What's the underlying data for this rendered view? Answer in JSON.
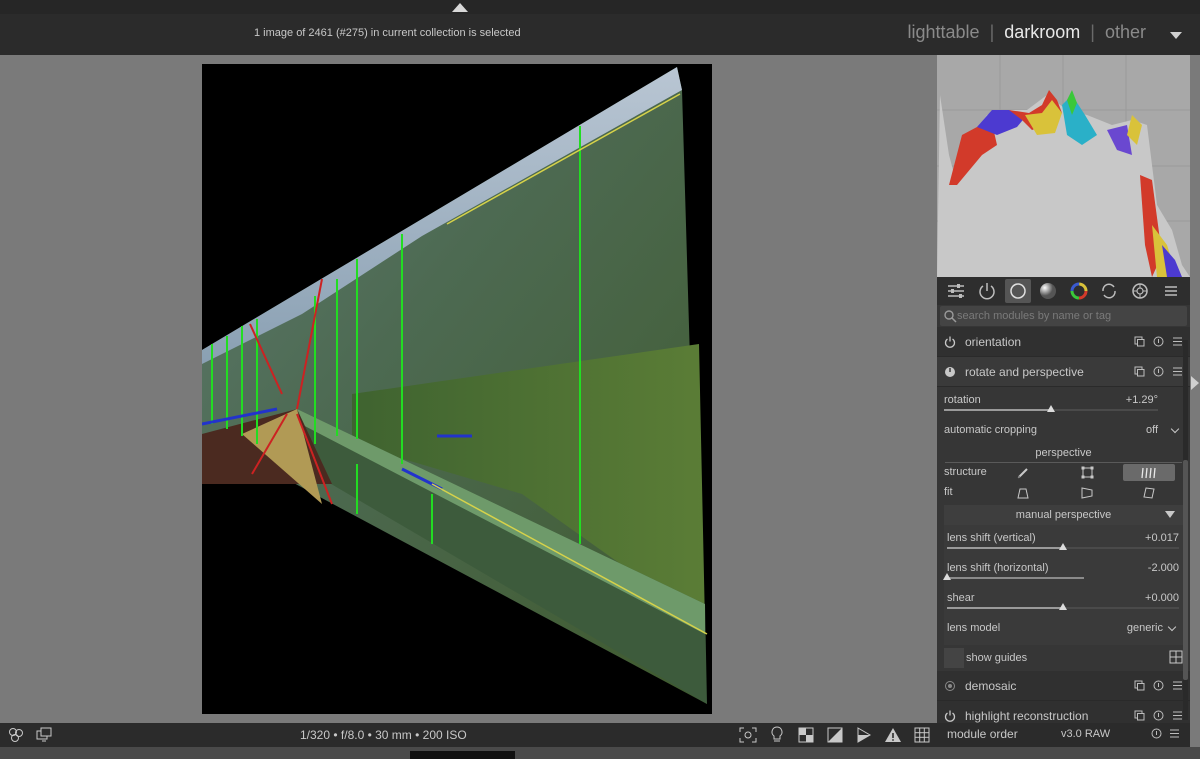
{
  "header": {
    "collection_info": "1 image of 2461 (#275) in current collection is selected",
    "views": [
      "lighttable",
      "darkroom",
      "other"
    ],
    "active_view": "darkroom"
  },
  "panel": {
    "search_placeholder": "search modules by name or tag",
    "groups": [
      "quick-access-icon",
      "power-icon",
      "base-circle-icon",
      "tone-gradient-icon",
      "color-wheel-icon",
      "correct-icon",
      "effect-icon",
      "presets-menu-icon"
    ],
    "modules": {
      "orientation": "orientation",
      "rotate_perspective": "rotate and perspective",
      "demosaic": "demosaic",
      "highlight": "highlight reconstruction"
    },
    "rotation": {
      "label": "rotation",
      "value": "+1.29°",
      "level": 0.5
    },
    "auto_crop": {
      "label": "automatic cropping",
      "value": "off"
    },
    "perspective_title": "perspective",
    "structure_label": "structure",
    "fit_label": "fit",
    "manual_perspective": "manual perspective",
    "lens_shift_v": {
      "label": "lens shift (vertical)",
      "value": "+0.017",
      "level": 0.5
    },
    "lens_shift_h": {
      "label": "lens shift (horizontal)",
      "value": "-2.000",
      "level": 0.0
    },
    "shear": {
      "label": "shear",
      "value": "+0.000",
      "level": 0.5
    },
    "lens_model": {
      "label": "lens model",
      "value": "generic"
    },
    "show_guides": "show guides",
    "module_order": {
      "label": "module order",
      "value": "v3.0 RAW"
    }
  },
  "bottom": {
    "exif": "1/320 • f/8.0 • 30 mm • 200 ISO"
  },
  "colors": {
    "background": "#7a7a7a",
    "panel": "#363636",
    "bar": "#2b2b2b",
    "guide_green": "#22dd22",
    "guide_red": "#cc2222",
    "guide_blue": "#2233cc"
  }
}
